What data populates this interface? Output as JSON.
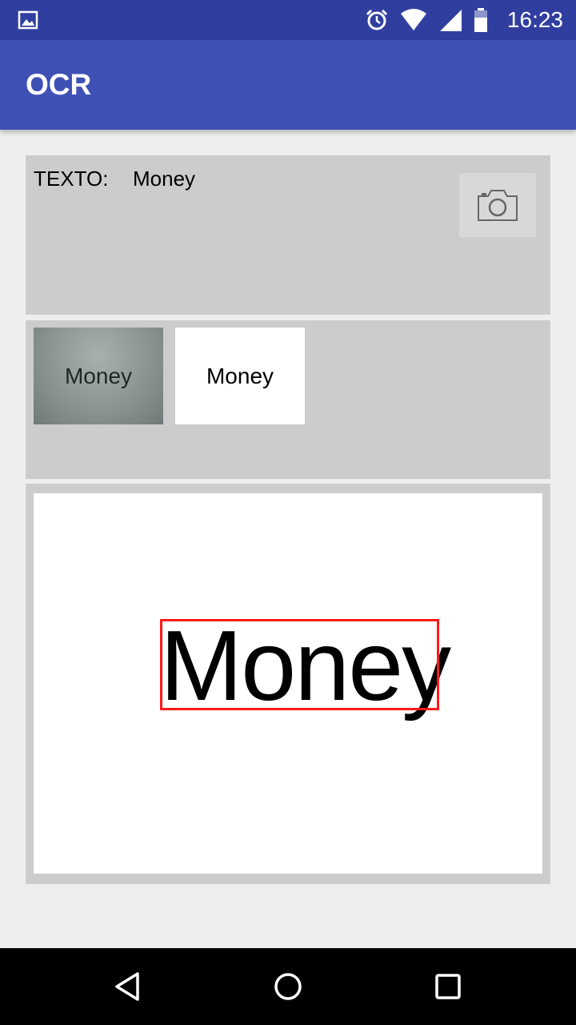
{
  "status_bar": {
    "time": "16:23",
    "icons": [
      "gallery-notification-icon",
      "alarm-icon",
      "wifi-icon",
      "cell-signal-icon",
      "battery-icon"
    ]
  },
  "app_bar": {
    "title": "OCR",
    "color": "#3f51b5"
  },
  "text_panel": {
    "label": "TEXTO:",
    "value": "Money",
    "camera_icon": "camera-icon"
  },
  "thumbnails": {
    "original_text": "Money",
    "processed_text": "Money"
  },
  "result": {
    "detected_word": "Money",
    "box_color": "#ff1a1a"
  },
  "nav_bar": {
    "icons": [
      "back-icon",
      "home-icon",
      "recents-icon"
    ]
  }
}
